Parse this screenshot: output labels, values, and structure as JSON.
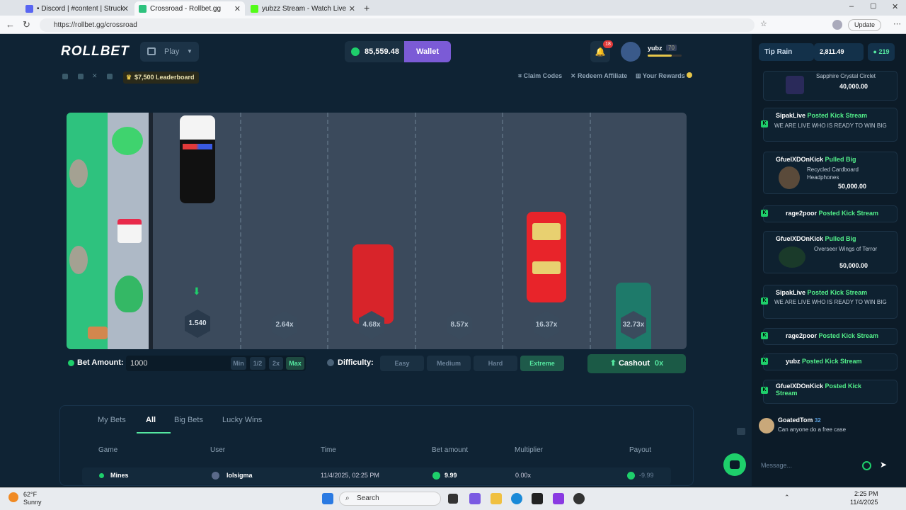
{
  "browser": {
    "tabs": [
      {
        "title": "• Discord | #content | Struck",
        "color": "#5865f2"
      },
      {
        "title": "Crossroad - Rollbet.gg",
        "color": "#2ec27e"
      },
      {
        "title": "yubzz Stream - Watch Live",
        "color": "#53fc18"
      }
    ],
    "url": "https://rollbet.gg/crossroad",
    "update_label": "Update"
  },
  "header": {
    "logo": "ROLLBET",
    "play_label": "Play",
    "balance": "85,559.48",
    "wallet_label": "Wallet",
    "notifications": "18",
    "username": "yubz",
    "level": "70"
  },
  "subbar": {
    "leaderboard": "$7,500 Leaderboard",
    "claim_codes": "Claim Codes",
    "redeem_affiliate": "Redeem Affiliate",
    "your_rewards": "Your Rewards"
  },
  "game": {
    "multipliers": [
      "1.540",
      "2.64x",
      "4.68x",
      "8.57x",
      "16.37x",
      "32.73x"
    ],
    "bet_label": "Bet Amount:",
    "bet_value": "1000",
    "quick": [
      "Min",
      "1/2",
      "2x",
      "Max"
    ],
    "difficulty_label": "Difficulty:",
    "difficulties": [
      "Easy",
      "Medium",
      "Hard",
      "Extreme"
    ],
    "selected_difficulty": "Extreme",
    "cashout_label": "Cashout",
    "cashout_value": "0x"
  },
  "bets": {
    "tabs": [
      "My Bets",
      "All",
      "Big Bets",
      "Lucky Wins"
    ],
    "selected_tab": "All",
    "columns": [
      "Game",
      "User",
      "Time",
      "Bet amount",
      "Multiplier",
      "Payout"
    ],
    "rows": [
      {
        "game": "Mines",
        "user": "lolsigma",
        "time": "11/4/2025, 02:25 PM",
        "bet": "9.99",
        "multiplier": "0.00x",
        "payout": "-9.99"
      }
    ]
  },
  "chat": {
    "tip_rain": "Tip Rain",
    "rain_amount": "2,811.49",
    "online": "219",
    "feed": [
      {
        "user": "",
        "action": "",
        "text": "Sapphire Crystal Circlet",
        "value": "40,000.00"
      },
      {
        "user": "SipakLive",
        "action": "Posted Kick Stream",
        "text": "WE ARE LIVE WHO IS READY TO WIN BIG",
        "value": ""
      },
      {
        "user": "GfuelXDOnKick",
        "action": "Pulled Big",
        "text": "Recycled Cardboard Headphones",
        "value": "50,000.00"
      },
      {
        "user": "rage2poor",
        "action": "Posted Kick Stream",
        "text": "",
        "value": ""
      },
      {
        "user": "GfuelXDOnKick",
        "action": "Pulled Big",
        "text": "Overseer Wings of Terror",
        "value": "50,000.00"
      },
      {
        "user": "SipakLive",
        "action": "Posted Kick Stream",
        "text": "WE ARE LIVE WHO IS READY TO WIN BIG",
        "value": ""
      },
      {
        "user": "rage2poor",
        "action": "Posted Kick Stream",
        "text": "",
        "value": ""
      },
      {
        "user": "yubz",
        "action": "Posted Kick Stream",
        "text": "",
        "value": ""
      },
      {
        "user": "GfuelXDOnKick",
        "action": "Posted Kick Stream",
        "text": "",
        "value": ""
      }
    ],
    "last_msg": {
      "user": "GoatedTom",
      "level": "32",
      "text": "Can anyone do a free case"
    },
    "placeholder": "Message..."
  },
  "taskbar": {
    "weather_temp": "62°F",
    "weather_desc": "Sunny",
    "search": "Search",
    "time": "2:25 PM",
    "date": "11/4/2025"
  },
  "colors": {
    "accent": "#55e7a0",
    "wallet": "#7b5bd6",
    "kick": "#1ecf6b"
  }
}
